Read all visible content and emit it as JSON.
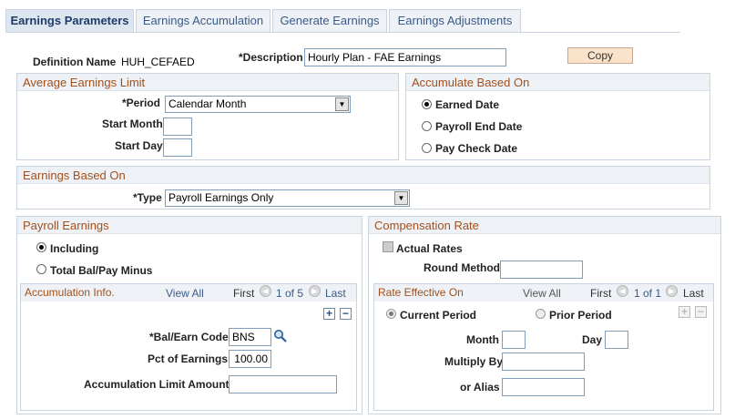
{
  "tabs": [
    {
      "label": "Earnings Parameters",
      "active": true
    },
    {
      "label": "Earnings Accumulation",
      "active": false
    },
    {
      "label": "Generate Earnings",
      "active": false
    },
    {
      "label": "Earnings Adjustments",
      "active": false
    }
  ],
  "header": {
    "definition_label": "Definition Name",
    "definition_value": "HUH_CEFAED",
    "description_label": "*Description",
    "description_value": "Hourly Plan - FAE Earnings",
    "copy_label": "Copy"
  },
  "avg_limit": {
    "title": "Average Earnings Limit",
    "period_label": "*Period",
    "period_value": "Calendar Month",
    "start_month_label": "Start Month",
    "start_month_value": "",
    "start_day_label": "Start Day",
    "start_day_value": ""
  },
  "accumulate": {
    "title": "Accumulate Based On",
    "options": [
      {
        "label": "Earned Date",
        "selected": true
      },
      {
        "label": "Payroll End Date",
        "selected": false
      },
      {
        "label": "Pay Check Date",
        "selected": false
      }
    ]
  },
  "earnings_based": {
    "title": "Earnings Based On",
    "type_label": "*Type",
    "type_value": "Payroll Earnings Only"
  },
  "payroll": {
    "title": "Payroll Earnings",
    "options": [
      {
        "label": "Including",
        "selected": true
      },
      {
        "label": "Total Bal/Pay Minus",
        "selected": false
      }
    ],
    "accum": {
      "title": "Accumulation Info.",
      "view_all": "View All",
      "first": "First",
      "counter": "1 of 5",
      "last": "Last",
      "bal_label": "*Bal/Earn Code",
      "bal_value": "BNS",
      "pct_label": "Pct of Earnings",
      "pct_value": "100.00",
      "limit_label": "Accumulation Limit Amount",
      "limit_value": ""
    }
  },
  "comp": {
    "title": "Compensation Rate",
    "actual_rates_label": "Actual Rates",
    "round_label": "Round Method",
    "round_value": "",
    "rate": {
      "title": "Rate Effective On",
      "view_all": "View All",
      "first": "First",
      "counter": "1 of 1",
      "last": "Last",
      "current_label": "Current Period",
      "prior_label": "Prior Period",
      "month_label": "Month",
      "month_value": "",
      "day_label": "Day",
      "day_value": "",
      "multiply_label": "Multiply By",
      "multiply_value": "",
      "alias_label": "or Alias",
      "alias_value": ""
    }
  }
}
